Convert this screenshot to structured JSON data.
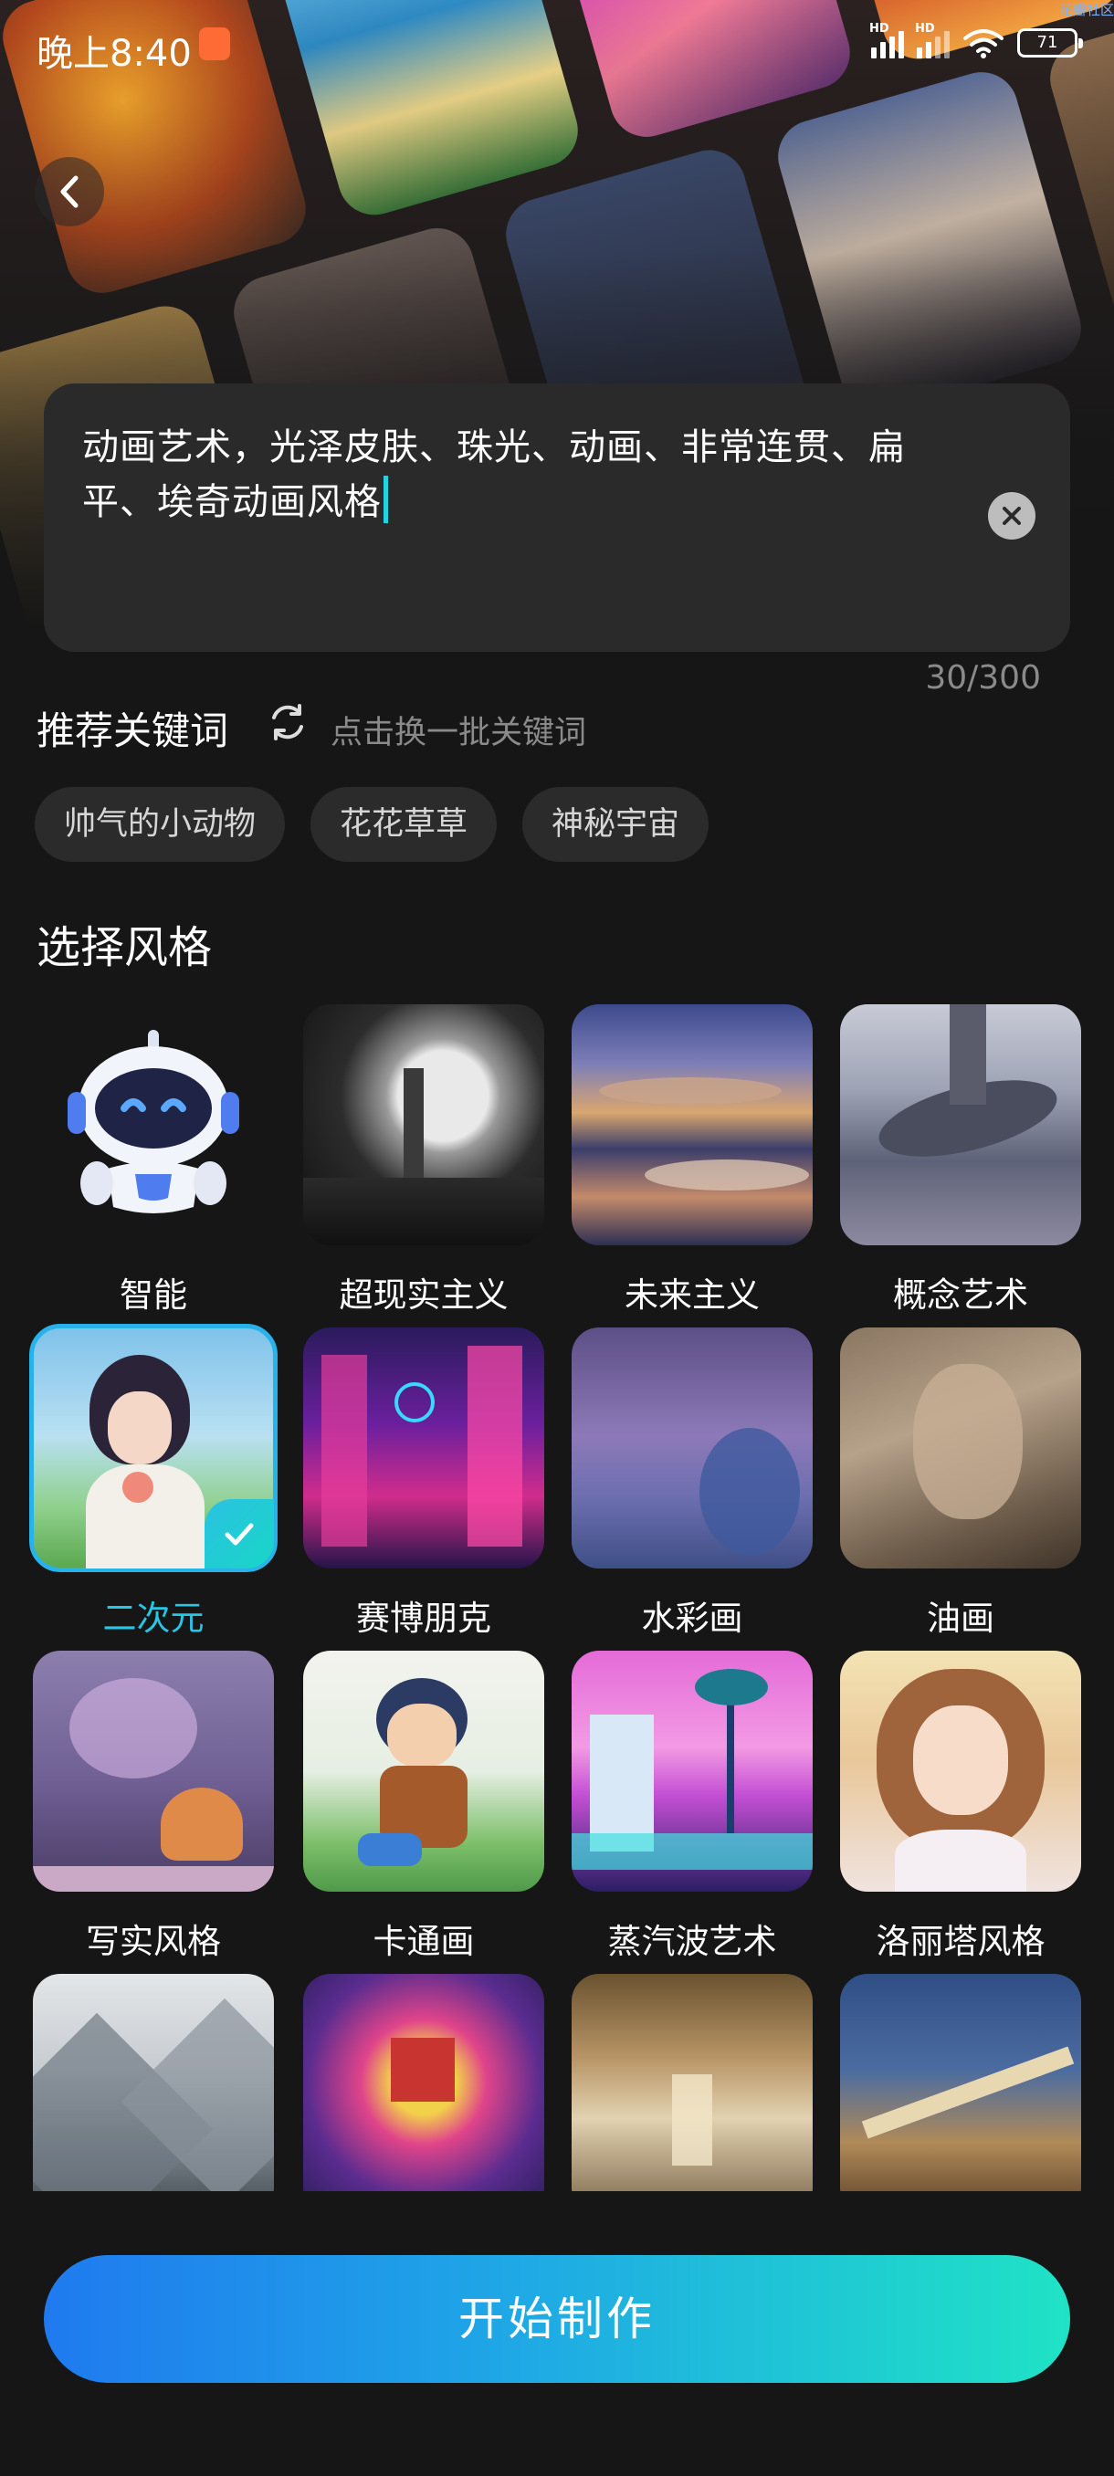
{
  "status_bar": {
    "time": "晚上8:40",
    "signal_1": "HD",
    "signal_2": "HD",
    "battery": "71",
    "corner_tag": "花瓣社区"
  },
  "prompt": {
    "text": "动画艺术，光泽皮肤、珠光、动画、非常连贯、扁平、埃奇动画风格",
    "char_count": "30/300"
  },
  "keywords": {
    "title": "推荐关键词",
    "hint": "点击换一批关键词",
    "chips": [
      "帅气的小动物",
      "花花草草",
      "神秘宇宙"
    ]
  },
  "styles": {
    "title": "选择风格",
    "selected_index": 4,
    "items": [
      {
        "label": "智能"
      },
      {
        "label": "超现实主义"
      },
      {
        "label": "未来主义"
      },
      {
        "label": "概念艺术"
      },
      {
        "label": "二次元"
      },
      {
        "label": "赛博朋克"
      },
      {
        "label": "水彩画"
      },
      {
        "label": "油画"
      },
      {
        "label": "写实风格"
      },
      {
        "label": "卡通画"
      },
      {
        "label": "蒸汽波艺术"
      },
      {
        "label": "洛丽塔风格"
      },
      {
        "label": ""
      },
      {
        "label": ""
      },
      {
        "label": ""
      },
      {
        "label": ""
      }
    ]
  },
  "start_button": {
    "label": "开始制作"
  },
  "colors": {
    "accent": "#27c6e6",
    "button_gradient_start": "#1f7aef",
    "button_gradient_end": "#1fe3c5",
    "background": "#161616"
  }
}
